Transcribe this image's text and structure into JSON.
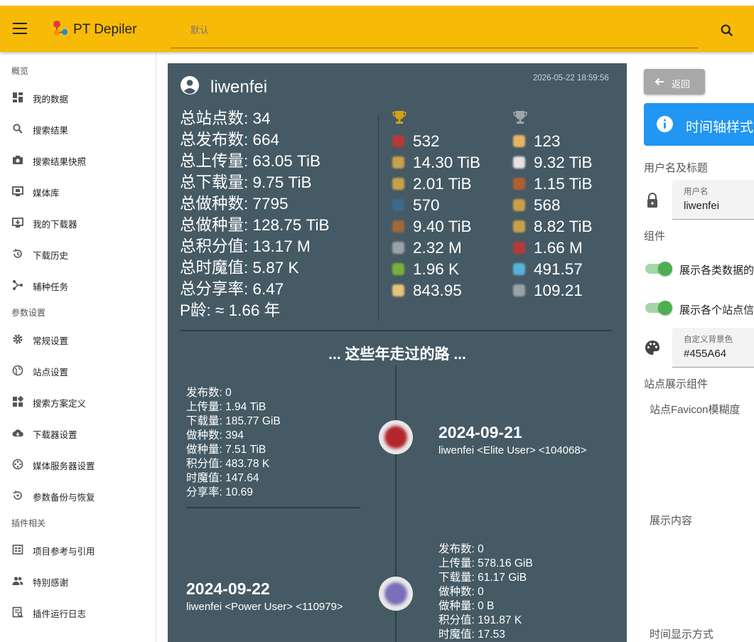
{
  "app": {
    "title": "PT Depiler",
    "search_placeholder": "默认"
  },
  "sidebar": {
    "sections": [
      {
        "label": "概览"
      },
      {
        "label": "参数设置"
      },
      {
        "label": "插件相关"
      }
    ],
    "items": [
      {
        "label": "我的数据",
        "icon": "dashboard-icon"
      },
      {
        "label": "搜索结果",
        "icon": "search-icon"
      },
      {
        "label": "搜索结果快照",
        "icon": "camera-icon"
      },
      {
        "label": "媒体库",
        "icon": "media-library-icon"
      },
      {
        "label": "我的下载器",
        "icon": "downloader-icon"
      },
      {
        "label": "下载历史",
        "icon": "history-icon"
      },
      {
        "label": "辅种任务",
        "icon": "branch-icon"
      },
      {
        "label": "常规设置",
        "icon": "gear-icon"
      },
      {
        "label": "站点设置",
        "icon": "globe-icon"
      },
      {
        "label": "搜索方案定义",
        "icon": "grid-icon"
      },
      {
        "label": "下载器设置",
        "icon": "cloud-download-icon"
      },
      {
        "label": "媒体服务器设置",
        "icon": "media-server-icon"
      },
      {
        "label": "参数备份与恢复",
        "icon": "backup-restore-icon"
      },
      {
        "label": "项目参考与引用",
        "icon": "reference-icon"
      },
      {
        "label": "特别感谢",
        "icon": "people-icon"
      },
      {
        "label": "插件运行日志",
        "icon": "log-icon"
      }
    ]
  },
  "card": {
    "username": "liwenfei",
    "timestamp": "2026-05-22 18:59:56",
    "background_color": "#455A64",
    "summary": [
      "总站点数: 34",
      "总发布数: 664",
      "总上传量: 63.05 TiB",
      "总下载量: 9.75 TiB",
      "总做种数: 7795",
      "总做种量: 128.75 TiB",
      "总积分值: 13.17 M",
      "总时魔值: 5.87 K",
      "总分享率: 6.47",
      "P龄: ≈ 1.66 年"
    ],
    "gold_column": {
      "trophy": "gold-trophy-icon",
      "values": [
        {
          "value": "532",
          "color": "#b43a3a"
        },
        {
          "value": "14.30 TiB",
          "color": "#c9a04a"
        },
        {
          "value": "2.01 TiB",
          "color": "#c9a04a"
        },
        {
          "value": "570",
          "color": "#3b6b8f"
        },
        {
          "value": "9.40 TiB",
          "color": "#a2683a"
        },
        {
          "value": "2.32 M",
          "color": "#9aa2a8"
        },
        {
          "value": "1.96 K",
          "color": "#7ab03a"
        },
        {
          "value": "843.95",
          "color": "#e8c27a"
        }
      ]
    },
    "silver_column": {
      "trophy": "silver-trophy-icon",
      "values": [
        {
          "value": "123",
          "color": "#e9b468"
        },
        {
          "value": "9.32 TiB",
          "color": "#e8e0e4"
        },
        {
          "value": "1.15 TiB",
          "color": "#b06030"
        },
        {
          "value": "568",
          "color": "#c9a04a"
        },
        {
          "value": "8.82 TiB",
          "color": "#c9a04a"
        },
        {
          "value": "1.66 M",
          "color": "#b43a3a"
        },
        {
          "value": "491.57",
          "color": "#5ab0d8"
        },
        {
          "value": "109.21",
          "color": "#9aa2a8"
        }
      ]
    },
    "timeline": {
      "title": "... 这些年走过的路 ...",
      "events": [
        {
          "date": "2024-09-21",
          "user": "liwenfei <Elite User> <104068>",
          "stats": [
            "发布数: 0",
            "上传量: 1.94 TiB",
            "下载量: 185.77 GiB",
            "做种数: 394",
            "做种量: 7.51 TiB",
            "积分值: 483.78 K",
            "时魔值: 147.64",
            "分享率: 10.69"
          ],
          "favicon_color": "#b3262c"
        },
        {
          "date": "2024-09-22",
          "user": "liwenfei <Power User> <110979>",
          "stats": [
            "发布数: 0",
            "上传量: 578.16 GiB",
            "下载量: 61.17 GiB",
            "做种数: 0",
            "做种量: 0 B",
            "积分值: 191.87 K",
            "时魔值: 17.53"
          ],
          "favicon_color": "#7a6fb8"
        }
      ]
    }
  },
  "settings": {
    "back_label": "返回",
    "info_text": "时间轴样式",
    "username_section": "用户名及标题",
    "username_field_label": "用户名",
    "username_field_value": "liwenfei",
    "components_section": "组件",
    "toggle_1_label": "展示各类数据的",
    "toggle_2_label": "展示各个站点信",
    "bgcolor_field_label": "自定义背景色",
    "bgcolor_field_value": "#455A64",
    "site_components_section": "站点展示组件",
    "favicon_blur_label": "站点Favicon模糊度",
    "display_content_label": "展示内容",
    "time_format_label": "时间显示方式"
  }
}
